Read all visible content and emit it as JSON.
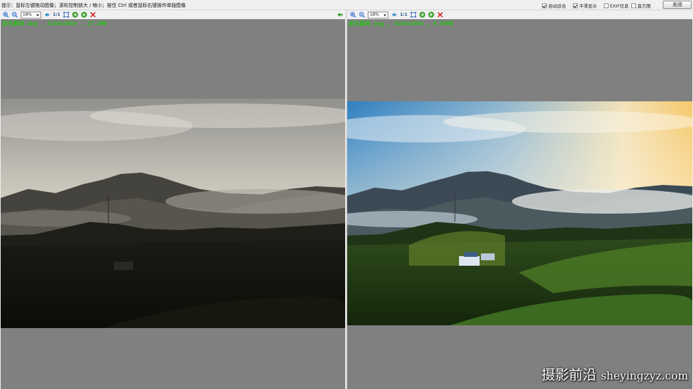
{
  "window": {
    "hint": "提示：鼠标左键拖动图像；滚轮控制放大 / 缩小；按住 Ctrl 或者鼠标右键操作单独图像",
    "options": [
      {
        "label": "自动适合",
        "checked": true
      },
      {
        "label": "平滑显示",
        "checked": true
      },
      {
        "label": "EXIF信息",
        "checked": false
      },
      {
        "label": "直方图",
        "checked": false
      }
    ],
    "close_label": "关闭"
  },
  "left_panel": {
    "zoom": "18%",
    "actual_size_label": "1:1",
    "file_info": "加元素材.dng , 5184x3456 , 17.1MB"
  },
  "right_panel": {
    "zoom": "18%",
    "actual_size_label": "1:1",
    "file_info": "加元素材.jpg , 5184x3384 , 9.95MB"
  },
  "watermark": {
    "cn": "摄影前沿",
    "en": "sheyingzyz.com"
  },
  "icons": {
    "zoom_in": "zoom-in-icon",
    "zoom_out": "zoom-out-icon",
    "fit": "fit-window-icon",
    "prev": "prev-image-icon",
    "next": "next-image-icon",
    "delete": "delete-icon",
    "rotate": "rotate-icon",
    "back": "back-arrow-icon"
  },
  "colors": {
    "info_text": "#27c217",
    "viewer_bg": "#808080",
    "delete_red": "#d42020",
    "icon_blue": "#2a6fd0",
    "icon_green": "#3aa030"
  }
}
